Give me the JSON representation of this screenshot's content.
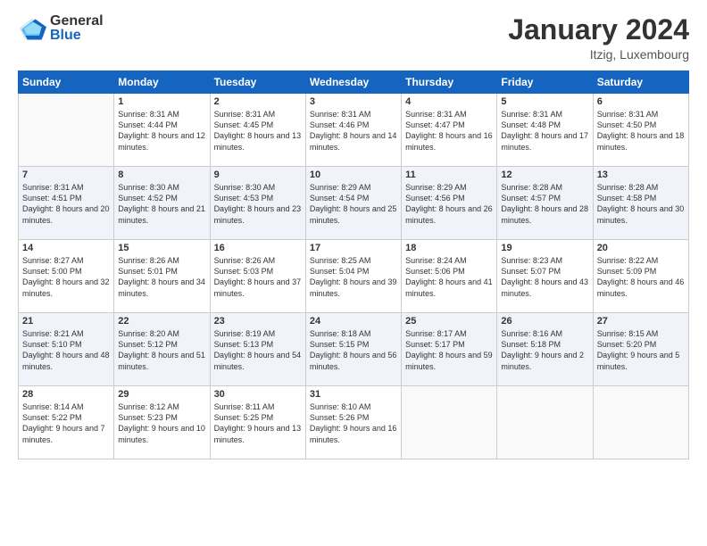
{
  "header": {
    "logo_general": "General",
    "logo_blue": "Blue",
    "month_title": "January 2024",
    "location": "Itzig, Luxembourg"
  },
  "weekdays": [
    "Sunday",
    "Monday",
    "Tuesday",
    "Wednesday",
    "Thursday",
    "Friday",
    "Saturday"
  ],
  "weeks": [
    [
      {
        "day": "",
        "sunrise": "",
        "sunset": "",
        "daylight": ""
      },
      {
        "day": "1",
        "sunrise": "Sunrise: 8:31 AM",
        "sunset": "Sunset: 4:44 PM",
        "daylight": "Daylight: 8 hours and 12 minutes."
      },
      {
        "day": "2",
        "sunrise": "Sunrise: 8:31 AM",
        "sunset": "Sunset: 4:45 PM",
        "daylight": "Daylight: 8 hours and 13 minutes."
      },
      {
        "day": "3",
        "sunrise": "Sunrise: 8:31 AM",
        "sunset": "Sunset: 4:46 PM",
        "daylight": "Daylight: 8 hours and 14 minutes."
      },
      {
        "day": "4",
        "sunrise": "Sunrise: 8:31 AM",
        "sunset": "Sunset: 4:47 PM",
        "daylight": "Daylight: 8 hours and 16 minutes."
      },
      {
        "day": "5",
        "sunrise": "Sunrise: 8:31 AM",
        "sunset": "Sunset: 4:48 PM",
        "daylight": "Daylight: 8 hours and 17 minutes."
      },
      {
        "day": "6",
        "sunrise": "Sunrise: 8:31 AM",
        "sunset": "Sunset: 4:50 PM",
        "daylight": "Daylight: 8 hours and 18 minutes."
      }
    ],
    [
      {
        "day": "7",
        "sunrise": "Sunrise: 8:31 AM",
        "sunset": "Sunset: 4:51 PM",
        "daylight": "Daylight: 8 hours and 20 minutes."
      },
      {
        "day": "8",
        "sunrise": "Sunrise: 8:30 AM",
        "sunset": "Sunset: 4:52 PM",
        "daylight": "Daylight: 8 hours and 21 minutes."
      },
      {
        "day": "9",
        "sunrise": "Sunrise: 8:30 AM",
        "sunset": "Sunset: 4:53 PM",
        "daylight": "Daylight: 8 hours and 23 minutes."
      },
      {
        "day": "10",
        "sunrise": "Sunrise: 8:29 AM",
        "sunset": "Sunset: 4:54 PM",
        "daylight": "Daylight: 8 hours and 25 minutes."
      },
      {
        "day": "11",
        "sunrise": "Sunrise: 8:29 AM",
        "sunset": "Sunset: 4:56 PM",
        "daylight": "Daylight: 8 hours and 26 minutes."
      },
      {
        "day": "12",
        "sunrise": "Sunrise: 8:28 AM",
        "sunset": "Sunset: 4:57 PM",
        "daylight": "Daylight: 8 hours and 28 minutes."
      },
      {
        "day": "13",
        "sunrise": "Sunrise: 8:28 AM",
        "sunset": "Sunset: 4:58 PM",
        "daylight": "Daylight: 8 hours and 30 minutes."
      }
    ],
    [
      {
        "day": "14",
        "sunrise": "Sunrise: 8:27 AM",
        "sunset": "Sunset: 5:00 PM",
        "daylight": "Daylight: 8 hours and 32 minutes."
      },
      {
        "day": "15",
        "sunrise": "Sunrise: 8:26 AM",
        "sunset": "Sunset: 5:01 PM",
        "daylight": "Daylight: 8 hours and 34 minutes."
      },
      {
        "day": "16",
        "sunrise": "Sunrise: 8:26 AM",
        "sunset": "Sunset: 5:03 PM",
        "daylight": "Daylight: 8 hours and 37 minutes."
      },
      {
        "day": "17",
        "sunrise": "Sunrise: 8:25 AM",
        "sunset": "Sunset: 5:04 PM",
        "daylight": "Daylight: 8 hours and 39 minutes."
      },
      {
        "day": "18",
        "sunrise": "Sunrise: 8:24 AM",
        "sunset": "Sunset: 5:06 PM",
        "daylight": "Daylight: 8 hours and 41 minutes."
      },
      {
        "day": "19",
        "sunrise": "Sunrise: 8:23 AM",
        "sunset": "Sunset: 5:07 PM",
        "daylight": "Daylight: 8 hours and 43 minutes."
      },
      {
        "day": "20",
        "sunrise": "Sunrise: 8:22 AM",
        "sunset": "Sunset: 5:09 PM",
        "daylight": "Daylight: 8 hours and 46 minutes."
      }
    ],
    [
      {
        "day": "21",
        "sunrise": "Sunrise: 8:21 AM",
        "sunset": "Sunset: 5:10 PM",
        "daylight": "Daylight: 8 hours and 48 minutes."
      },
      {
        "day": "22",
        "sunrise": "Sunrise: 8:20 AM",
        "sunset": "Sunset: 5:12 PM",
        "daylight": "Daylight: 8 hours and 51 minutes."
      },
      {
        "day": "23",
        "sunrise": "Sunrise: 8:19 AM",
        "sunset": "Sunset: 5:13 PM",
        "daylight": "Daylight: 8 hours and 54 minutes."
      },
      {
        "day": "24",
        "sunrise": "Sunrise: 8:18 AM",
        "sunset": "Sunset: 5:15 PM",
        "daylight": "Daylight: 8 hours and 56 minutes."
      },
      {
        "day": "25",
        "sunrise": "Sunrise: 8:17 AM",
        "sunset": "Sunset: 5:17 PM",
        "daylight": "Daylight: 8 hours and 59 minutes."
      },
      {
        "day": "26",
        "sunrise": "Sunrise: 8:16 AM",
        "sunset": "Sunset: 5:18 PM",
        "daylight": "Daylight: 9 hours and 2 minutes."
      },
      {
        "day": "27",
        "sunrise": "Sunrise: 8:15 AM",
        "sunset": "Sunset: 5:20 PM",
        "daylight": "Daylight: 9 hours and 5 minutes."
      }
    ],
    [
      {
        "day": "28",
        "sunrise": "Sunrise: 8:14 AM",
        "sunset": "Sunset: 5:22 PM",
        "daylight": "Daylight: 9 hours and 7 minutes."
      },
      {
        "day": "29",
        "sunrise": "Sunrise: 8:12 AM",
        "sunset": "Sunset: 5:23 PM",
        "daylight": "Daylight: 9 hours and 10 minutes."
      },
      {
        "day": "30",
        "sunrise": "Sunrise: 8:11 AM",
        "sunset": "Sunset: 5:25 PM",
        "daylight": "Daylight: 9 hours and 13 minutes."
      },
      {
        "day": "31",
        "sunrise": "Sunrise: 8:10 AM",
        "sunset": "Sunset: 5:26 PM",
        "daylight": "Daylight: 9 hours and 16 minutes."
      },
      {
        "day": "",
        "sunrise": "",
        "sunset": "",
        "daylight": ""
      },
      {
        "day": "",
        "sunrise": "",
        "sunset": "",
        "daylight": ""
      },
      {
        "day": "",
        "sunrise": "",
        "sunset": "",
        "daylight": ""
      }
    ]
  ]
}
